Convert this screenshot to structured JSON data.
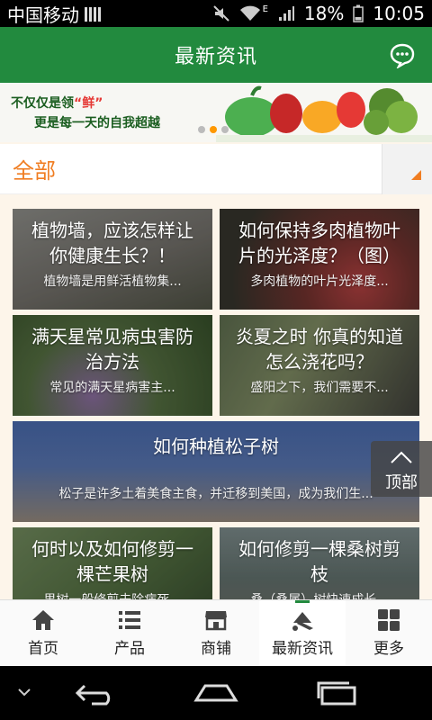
{
  "status_bar": {
    "carrier": "中国移动",
    "battery": "18%",
    "time": "10:05",
    "network": "E"
  },
  "header": {
    "title": "最新资讯"
  },
  "banner": {
    "line1_prefix": "不仅仅是领",
    "line1_highlight": "“鲜”",
    "line2": "更是每一天的自我超越"
  },
  "category": {
    "label": "全部"
  },
  "articles": [
    {
      "title": "植物墙，应该怎样让你健康生长？！",
      "summary": "植物墙是用鲜活植物集..."
    },
    {
      "title": "如何保持多肉植物叶片的光泽度？（图）",
      "summary": "多肉植物的叶片光泽度..."
    },
    {
      "title": "满天星常见病虫害防治方法",
      "summary": "常见的满天星病害主..."
    },
    {
      "title": "炎夏之时 你真的知道怎么浇花吗？",
      "summary": "盛阳之下，我们需要不..."
    },
    {
      "title": "如何种植松子树",
      "summary": "松子是许多土着美食主食，并迁移到美国，成为我们生..."
    },
    {
      "title": "何时以及如何修剪一棵芒果树",
      "summary": "果树一般修剪去除病死..."
    },
    {
      "title": "如何修剪一棵桑树剪枝",
      "summary": "桑（桑属）树快速成长..."
    }
  ],
  "top_button": {
    "label": "顶部"
  },
  "bottom_nav": [
    {
      "label": "首页",
      "icon": "home-icon"
    },
    {
      "label": "产品",
      "icon": "list-icon"
    },
    {
      "label": "商铺",
      "icon": "shop-icon"
    },
    {
      "label": "最新资讯",
      "icon": "news-icon",
      "active": true
    },
    {
      "label": "更多",
      "icon": "grid-icon"
    }
  ],
  "colors": {
    "primary": "#228a3e",
    "accent": "#f07d22",
    "background": "#fdf5ea"
  }
}
